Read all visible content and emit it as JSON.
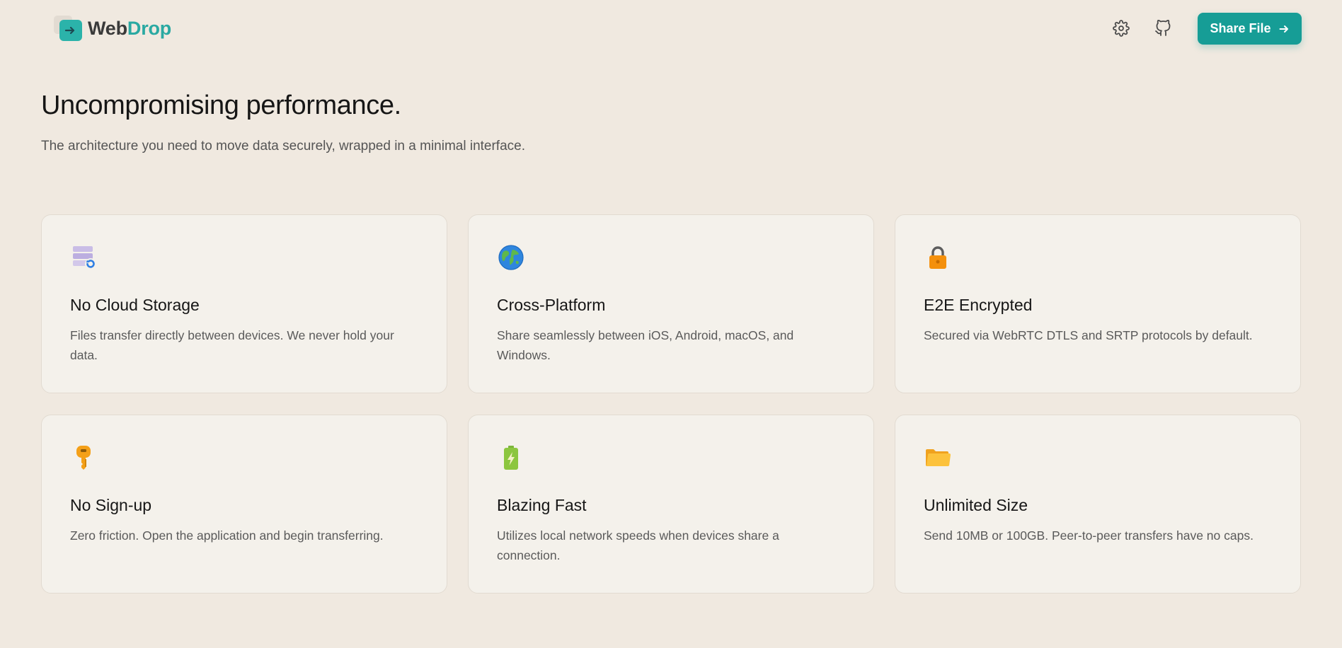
{
  "header": {
    "logo": {
      "part1": "Web",
      "part2": "Drop"
    },
    "share_label": "Share File",
    "icons": [
      "gear-icon",
      "github-icon",
      "arrow-right-icon"
    ]
  },
  "hero": {
    "title": "Uncompromising performance.",
    "subtitle": "The architecture you need to move data securely, wrapped in a minimal interface."
  },
  "features": [
    {
      "icon": "database-sync-icon",
      "title": "No Cloud Storage",
      "desc": "Files transfer directly between devices. We never hold your data."
    },
    {
      "icon": "globe-icon",
      "title": "Cross-Platform",
      "desc": "Share seamlessly between iOS, Android, macOS, and Windows."
    },
    {
      "icon": "lock-icon",
      "title": "E2E Encrypted",
      "desc": "Secured via WebRTC DTLS and SRTP protocols by default."
    },
    {
      "icon": "key-icon",
      "title": "No Sign-up",
      "desc": "Zero friction. Open the application and begin transferring."
    },
    {
      "icon": "battery-bolt-icon",
      "title": "Blazing Fast",
      "desc": "Utilizes local network speeds when devices share a connection."
    },
    {
      "icon": "folder-icon",
      "title": "Unlimited Size",
      "desc": "Send 10MB or 100GB. Peer-to-peer transfers have no caps."
    }
  ],
  "colors": {
    "background": "#f0e9e0",
    "card": "#f4f1eb",
    "accent": "#169d96",
    "logo_teal": "#2aa9a2"
  }
}
